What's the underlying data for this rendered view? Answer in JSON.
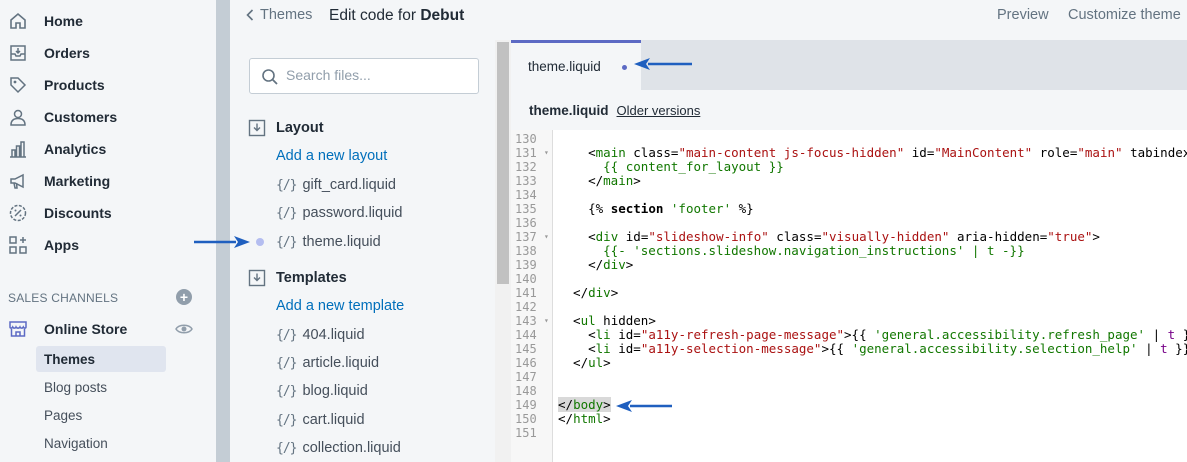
{
  "nav": {
    "items": [
      {
        "label": "Home",
        "icon": "home-icon"
      },
      {
        "label": "Orders",
        "icon": "orders-icon"
      },
      {
        "label": "Products",
        "icon": "tag-icon"
      },
      {
        "label": "Customers",
        "icon": "person-icon"
      },
      {
        "label": "Analytics",
        "icon": "bar-chart-icon"
      },
      {
        "label": "Marketing",
        "icon": "megaphone-icon"
      },
      {
        "label": "Discounts",
        "icon": "discount-icon"
      },
      {
        "label": "Apps",
        "icon": "apps-icon"
      }
    ],
    "sales_channels_label": "SALES CHANNELS",
    "online_store_label": "Online Store",
    "online_store_sub": [
      {
        "label": "Themes",
        "active": true
      },
      {
        "label": "Blog posts",
        "active": false
      },
      {
        "label": "Pages",
        "active": false
      },
      {
        "label": "Navigation",
        "active": false
      }
    ]
  },
  "header": {
    "back_label": "Themes",
    "title_prefix": "Edit code for",
    "theme_name": "Debut",
    "preview_label": "Preview",
    "customize_label": "Customize theme"
  },
  "files": {
    "search_placeholder": "Search files...",
    "layout_folder": "Layout",
    "add_layout": "Add a new layout",
    "layout_files": [
      "gift_card.liquid",
      "password.liquid",
      "theme.liquid"
    ],
    "templates_folder": "Templates",
    "add_template": "Add a new template",
    "template_files": [
      "404.liquid",
      "article.liquid",
      "blog.liquid",
      "cart.liquid",
      "collection.liquid"
    ],
    "file_icon_text": "{/}"
  },
  "editor": {
    "tab_label": "theme.liquid",
    "file_name": "theme.liquid",
    "older_versions": "Older versions",
    "line_numbers": [
      "130",
      "131",
      "132",
      "133",
      "134",
      "135",
      "136",
      "137",
      "138",
      "139",
      "140",
      "141",
      "142",
      "143",
      "144",
      "145",
      "146",
      "147",
      "148",
      "149",
      "150",
      "151"
    ]
  },
  "colors": {
    "link": "#006fbb",
    "accent": "#5c6ac4",
    "arrow": "#1f5fbf"
  }
}
